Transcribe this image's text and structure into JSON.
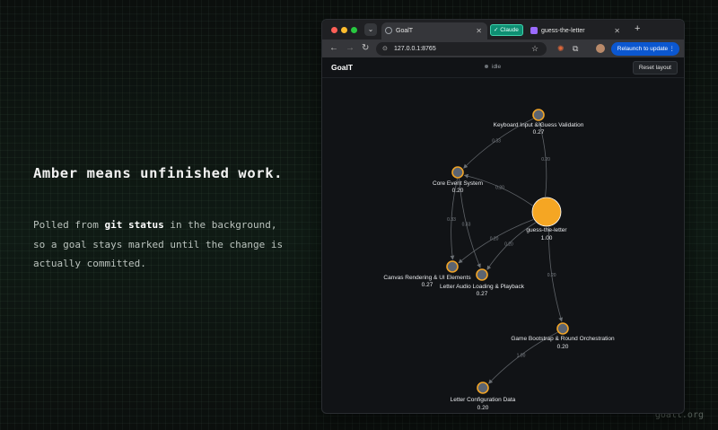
{
  "left_panel": {
    "headline": "Amber means unfinished work.",
    "body_prefix": "Polled from ",
    "body_emphasis": "git status",
    "body_suffix": " in the background, so a goal stays marked until the change is actually committed."
  },
  "footer": {
    "brand": "goalt.org"
  },
  "browser": {
    "tabs": [
      {
        "label": "GoalT",
        "active": true
      },
      {
        "label": "guess-the-letter",
        "active": false
      }
    ],
    "claude_chip": "Claude",
    "new_tab": "+",
    "address": "127.0.0.1:8765",
    "relaunch": "Relaunch to update",
    "icons": {
      "back": "back-arrow-icon",
      "forward": "forward-arrow-icon",
      "reload": "reload-icon",
      "bookmark": "star-icon",
      "extensions": "puzzle-icon"
    }
  },
  "app": {
    "title": "GoalT",
    "status": "idle",
    "reset_button": "Reset layout"
  },
  "colors": {
    "amber_node": "#f5a623",
    "pending_node_fill": "#5b6472",
    "node_ring": "#f0a428",
    "edge": "#5f6368",
    "label": "#e8eaed"
  },
  "graph": {
    "nodes": [
      {
        "id": "root",
        "label": "guess-the-letter",
        "value": "1.00"
      },
      {
        "id": "keyboard",
        "label": "Keyboard Input & Guess Validation",
        "value": "0.27"
      },
      {
        "id": "core",
        "label": "Core Event System",
        "value": "0.20"
      },
      {
        "id": "canvas",
        "label": "Canvas Rendering & UI Elements",
        "value": "0.27"
      },
      {
        "id": "audio",
        "label": "Letter Audio Loading & Playback",
        "value": "0.27"
      },
      {
        "id": "bootstrap",
        "label": "Game Bootstrap & Round Orchestration",
        "value": "0.20"
      },
      {
        "id": "config",
        "label": "Letter Configuration Data",
        "value": "0.20"
      }
    ],
    "edges": [
      {
        "from": "keyboard",
        "to": "core",
        "weight": "0.33"
      },
      {
        "from": "root",
        "to": "keyboard",
        "weight": "0.20"
      },
      {
        "from": "root",
        "to": "core",
        "weight": "0.20"
      },
      {
        "from": "core",
        "to": "canvas",
        "weight": "0.33"
      },
      {
        "from": "core",
        "to": "audio",
        "weight": "0.33"
      },
      {
        "from": "root",
        "to": "audio",
        "weight": "0.20"
      },
      {
        "from": "root",
        "to": "canvas",
        "weight": "0.20"
      },
      {
        "from": "root",
        "to": "bootstrap",
        "weight": "0.20"
      },
      {
        "from": "bootstrap",
        "to": "config",
        "weight": "1.00"
      }
    ]
  }
}
